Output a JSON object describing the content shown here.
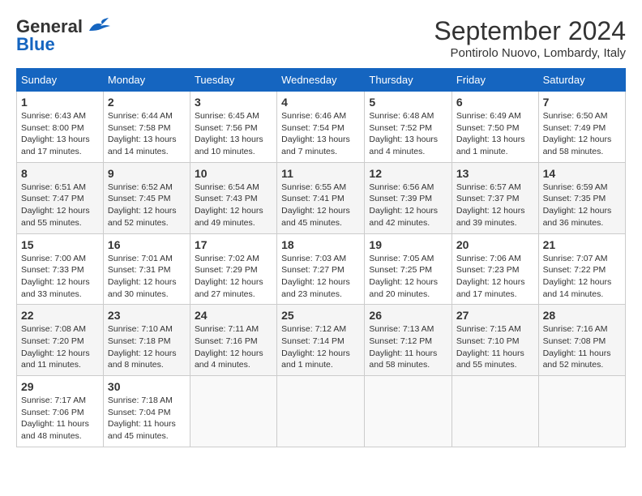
{
  "header": {
    "logo_general": "General",
    "logo_blue": "Blue",
    "title": "September 2024",
    "subtitle": "Pontirolo Nuovo, Lombardy, Italy"
  },
  "columns": [
    "Sunday",
    "Monday",
    "Tuesday",
    "Wednesday",
    "Thursday",
    "Friday",
    "Saturday"
  ],
  "weeks": [
    [
      {
        "day": "1",
        "info": "Sunrise: 6:43 AM\nSunset: 8:00 PM\nDaylight: 13 hours and 17 minutes."
      },
      {
        "day": "2",
        "info": "Sunrise: 6:44 AM\nSunset: 7:58 PM\nDaylight: 13 hours and 14 minutes."
      },
      {
        "day": "3",
        "info": "Sunrise: 6:45 AM\nSunset: 7:56 PM\nDaylight: 13 hours and 10 minutes."
      },
      {
        "day": "4",
        "info": "Sunrise: 6:46 AM\nSunset: 7:54 PM\nDaylight: 13 hours and 7 minutes."
      },
      {
        "day": "5",
        "info": "Sunrise: 6:48 AM\nSunset: 7:52 PM\nDaylight: 13 hours and 4 minutes."
      },
      {
        "day": "6",
        "info": "Sunrise: 6:49 AM\nSunset: 7:50 PM\nDaylight: 13 hours and 1 minute."
      },
      {
        "day": "7",
        "info": "Sunrise: 6:50 AM\nSunset: 7:49 PM\nDaylight: 12 hours and 58 minutes."
      }
    ],
    [
      {
        "day": "8",
        "info": "Sunrise: 6:51 AM\nSunset: 7:47 PM\nDaylight: 12 hours and 55 minutes."
      },
      {
        "day": "9",
        "info": "Sunrise: 6:52 AM\nSunset: 7:45 PM\nDaylight: 12 hours and 52 minutes."
      },
      {
        "day": "10",
        "info": "Sunrise: 6:54 AM\nSunset: 7:43 PM\nDaylight: 12 hours and 49 minutes."
      },
      {
        "day": "11",
        "info": "Sunrise: 6:55 AM\nSunset: 7:41 PM\nDaylight: 12 hours and 45 minutes."
      },
      {
        "day": "12",
        "info": "Sunrise: 6:56 AM\nSunset: 7:39 PM\nDaylight: 12 hours and 42 minutes."
      },
      {
        "day": "13",
        "info": "Sunrise: 6:57 AM\nSunset: 7:37 PM\nDaylight: 12 hours and 39 minutes."
      },
      {
        "day": "14",
        "info": "Sunrise: 6:59 AM\nSunset: 7:35 PM\nDaylight: 12 hours and 36 minutes."
      }
    ],
    [
      {
        "day": "15",
        "info": "Sunrise: 7:00 AM\nSunset: 7:33 PM\nDaylight: 12 hours and 33 minutes."
      },
      {
        "day": "16",
        "info": "Sunrise: 7:01 AM\nSunset: 7:31 PM\nDaylight: 12 hours and 30 minutes."
      },
      {
        "day": "17",
        "info": "Sunrise: 7:02 AM\nSunset: 7:29 PM\nDaylight: 12 hours and 27 minutes."
      },
      {
        "day": "18",
        "info": "Sunrise: 7:03 AM\nSunset: 7:27 PM\nDaylight: 12 hours and 23 minutes."
      },
      {
        "day": "19",
        "info": "Sunrise: 7:05 AM\nSunset: 7:25 PM\nDaylight: 12 hours and 20 minutes."
      },
      {
        "day": "20",
        "info": "Sunrise: 7:06 AM\nSunset: 7:23 PM\nDaylight: 12 hours and 17 minutes."
      },
      {
        "day": "21",
        "info": "Sunrise: 7:07 AM\nSunset: 7:22 PM\nDaylight: 12 hours and 14 minutes."
      }
    ],
    [
      {
        "day": "22",
        "info": "Sunrise: 7:08 AM\nSunset: 7:20 PM\nDaylight: 12 hours and 11 minutes."
      },
      {
        "day": "23",
        "info": "Sunrise: 7:10 AM\nSunset: 7:18 PM\nDaylight: 12 hours and 8 minutes."
      },
      {
        "day": "24",
        "info": "Sunrise: 7:11 AM\nSunset: 7:16 PM\nDaylight: 12 hours and 4 minutes."
      },
      {
        "day": "25",
        "info": "Sunrise: 7:12 AM\nSunset: 7:14 PM\nDaylight: 12 hours and 1 minute."
      },
      {
        "day": "26",
        "info": "Sunrise: 7:13 AM\nSunset: 7:12 PM\nDaylight: 11 hours and 58 minutes."
      },
      {
        "day": "27",
        "info": "Sunrise: 7:15 AM\nSunset: 7:10 PM\nDaylight: 11 hours and 55 minutes."
      },
      {
        "day": "28",
        "info": "Sunrise: 7:16 AM\nSunset: 7:08 PM\nDaylight: 11 hours and 52 minutes."
      }
    ],
    [
      {
        "day": "29",
        "info": "Sunrise: 7:17 AM\nSunset: 7:06 PM\nDaylight: 11 hours and 48 minutes."
      },
      {
        "day": "30",
        "info": "Sunrise: 7:18 AM\nSunset: 7:04 PM\nDaylight: 11 hours and 45 minutes."
      },
      {
        "day": "",
        "info": ""
      },
      {
        "day": "",
        "info": ""
      },
      {
        "day": "",
        "info": ""
      },
      {
        "day": "",
        "info": ""
      },
      {
        "day": "",
        "info": ""
      }
    ]
  ]
}
